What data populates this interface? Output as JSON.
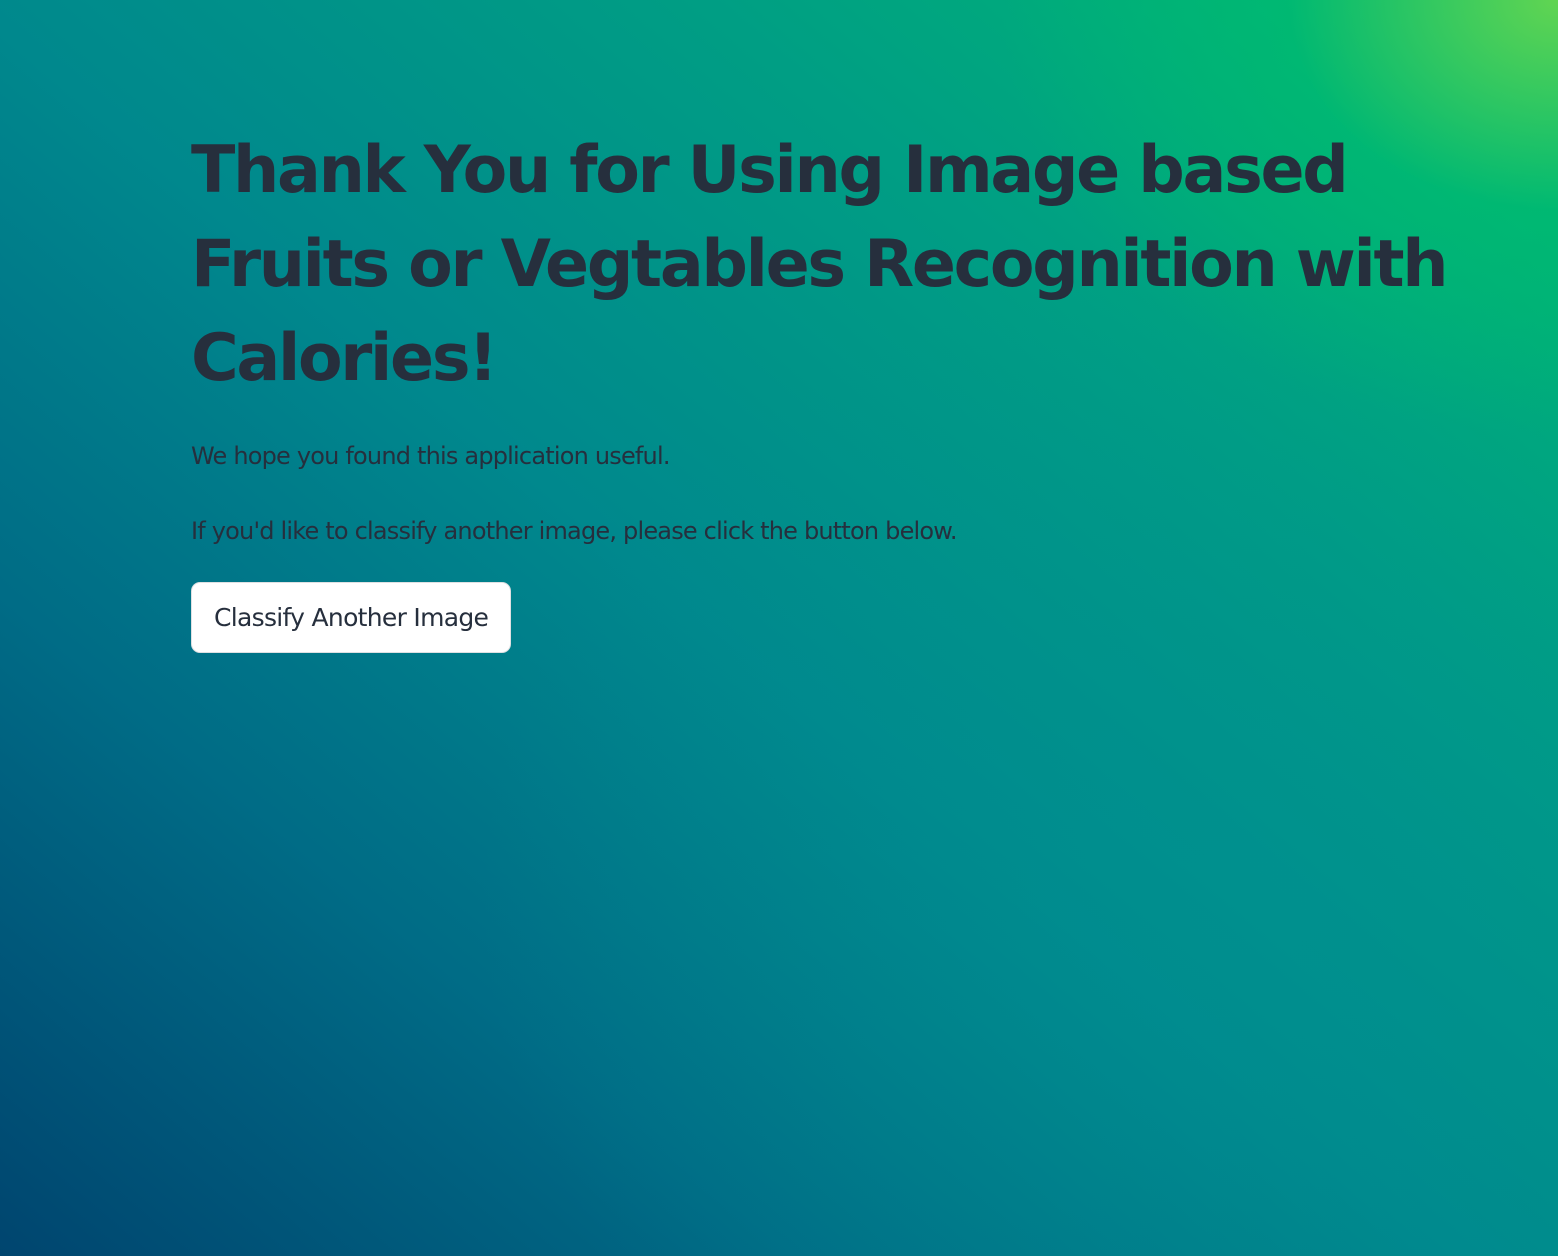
{
  "main": {
    "title": "Thank You for Using Image based Fruits or Vegtables Recognition with Calories!",
    "paragraph_1": "We hope you found this application useful.",
    "paragraph_2": "If you'd like to classify another image, please click the button below.",
    "button_label": "Classify Another Image"
  },
  "colors": {
    "text": "#262f3d",
    "button_background": "#ffffff",
    "background_dark": "#00456f",
    "background_green": "#00bb72",
    "background_lime": "#66d650"
  }
}
